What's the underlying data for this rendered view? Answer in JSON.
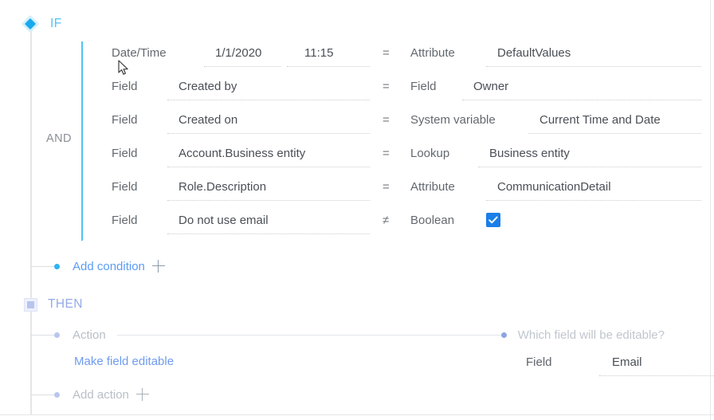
{
  "blocks": {
    "if": {
      "label": "IF",
      "icon": "diamond-icon"
    },
    "then": {
      "label": "THEN",
      "icon": "square-icon"
    }
  },
  "operator_group": {
    "label": "AND"
  },
  "conditions": [
    {
      "left_type": "Date/Time",
      "left_value": "1/1/2020",
      "left_value_2": "11:15",
      "operator": "=",
      "right_type": "Attribute",
      "right_value": "DefaultValues"
    },
    {
      "left_type": "Field",
      "left_value": "Created by",
      "operator": "=",
      "right_type": "Field",
      "right_value": "Owner"
    },
    {
      "left_type": "Field",
      "left_value": "Created on",
      "operator": "=",
      "right_type": "System variable",
      "right_value": "Current Time and Date"
    },
    {
      "left_type": "Field",
      "left_value": "Account.Business entity",
      "operator": "=",
      "right_type": "Lookup",
      "right_value": "Business entity"
    },
    {
      "left_type": "Field",
      "left_value": "Role.Description",
      "operator": "=",
      "right_type": "Attribute",
      "right_value": "CommunicationDetail"
    },
    {
      "left_type": "Field",
      "left_value": "Do not use email",
      "operator": "≠",
      "right_type": "Boolean",
      "right_value": "",
      "right_checkbox": true
    }
  ],
  "add_condition": {
    "label": "Add condition",
    "icon": "plus-icon"
  },
  "then_section": {
    "action_header": "Action",
    "question_header": "Which field will be editable?",
    "action_link": "Make field editable",
    "field_label": "Field",
    "field_value": "Email",
    "add_action": {
      "label": "Add action",
      "icon": "plus-icon"
    }
  },
  "colors": {
    "accent_blue": "#4ec3f7",
    "link_blue": "#5b9cf5",
    "checkbox_blue": "#1a7fe8",
    "muted_text": "#b9bfc7",
    "body_text": "#5f646b"
  }
}
